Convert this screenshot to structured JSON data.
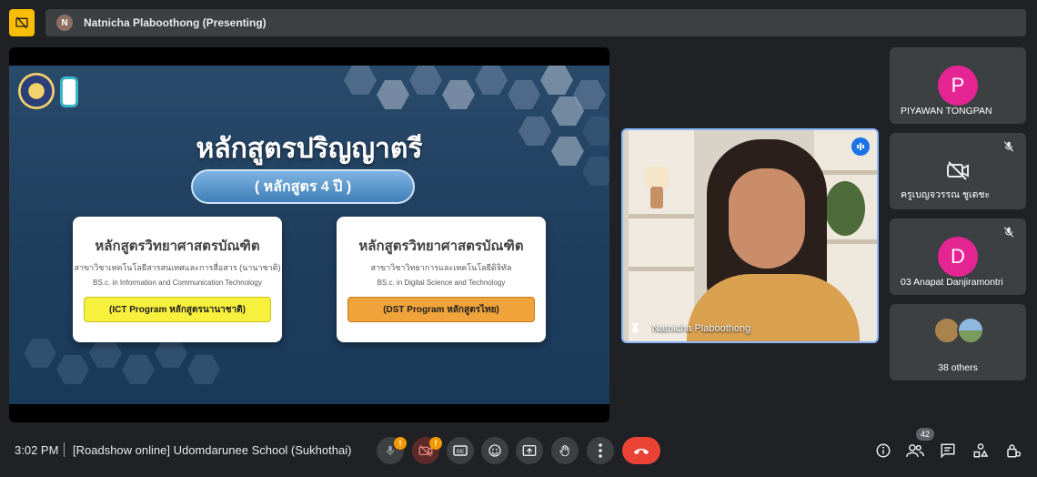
{
  "header": {
    "presenter_initial": "N",
    "presenting_text": "Natnicha Plaboothong (Presenting)"
  },
  "slide": {
    "title": "หลักสูตรปริญญาตรี",
    "subtitle": "( หลักสูตร 4 ปี )",
    "cards": [
      {
        "heading": "หลักสูตรวิทยาศาสตรบัณฑิต",
        "thai_sub": "สาขาวิชาเทคโนโลยีสารสนเทศและการสื่อสาร (นานาชาติ)",
        "english": "BS.c. in Information and Communication Technology",
        "button": "(ICT Program หลักสูตรนานาชาติ)",
        "button_color": "#f7f03c"
      },
      {
        "heading": "หลักสูตรวิทยาศาสตรบัณฑิต",
        "thai_sub": "สาขาวิชาวิทยาการและเทคโนโลยีดิจิทัล",
        "english": "BS.c. in Digital Science and Technology",
        "button": "(DST Program หลักสูตรไทย)",
        "button_color": "#f0a33a"
      }
    ]
  },
  "camera": {
    "name": "Natnicha Plaboothong"
  },
  "participants": [
    {
      "initial": "P",
      "name": "PIYAWAN TONGPAN",
      "avatar_color": "#e52592"
    },
    {
      "name": "ครูเบญจวรรณ ชูเดชะ",
      "muted": true
    },
    {
      "initial": "D",
      "name": "03 Anapat Danjiramontri",
      "avatar_color": "#e52592",
      "muted": true
    },
    {
      "others_label": "38 others"
    }
  ],
  "footer": {
    "time": "3:02 PM",
    "meeting_name": "[Roadshow online] Udomdarunee School (Sukhothai)",
    "participant_count": "42",
    "mic_badge": "!",
    "cam_badge": "!"
  },
  "icons": {
    "top_left": "present-off-icon",
    "controls": [
      "mic-icon",
      "camera-off-icon",
      "captions-icon",
      "emoji-icon",
      "present-icon",
      "raise-hand-icon",
      "more-icon",
      "hangup-icon"
    ],
    "right": [
      "info-icon",
      "people-icon",
      "chat-icon",
      "activities-icon",
      "host-controls-icon"
    ]
  },
  "colors": {
    "accent_blue": "#8ab4f8",
    "hangup_red": "#ea4335",
    "warning_yellow": "#fbbc04",
    "avatar_pink": "#e52592"
  }
}
